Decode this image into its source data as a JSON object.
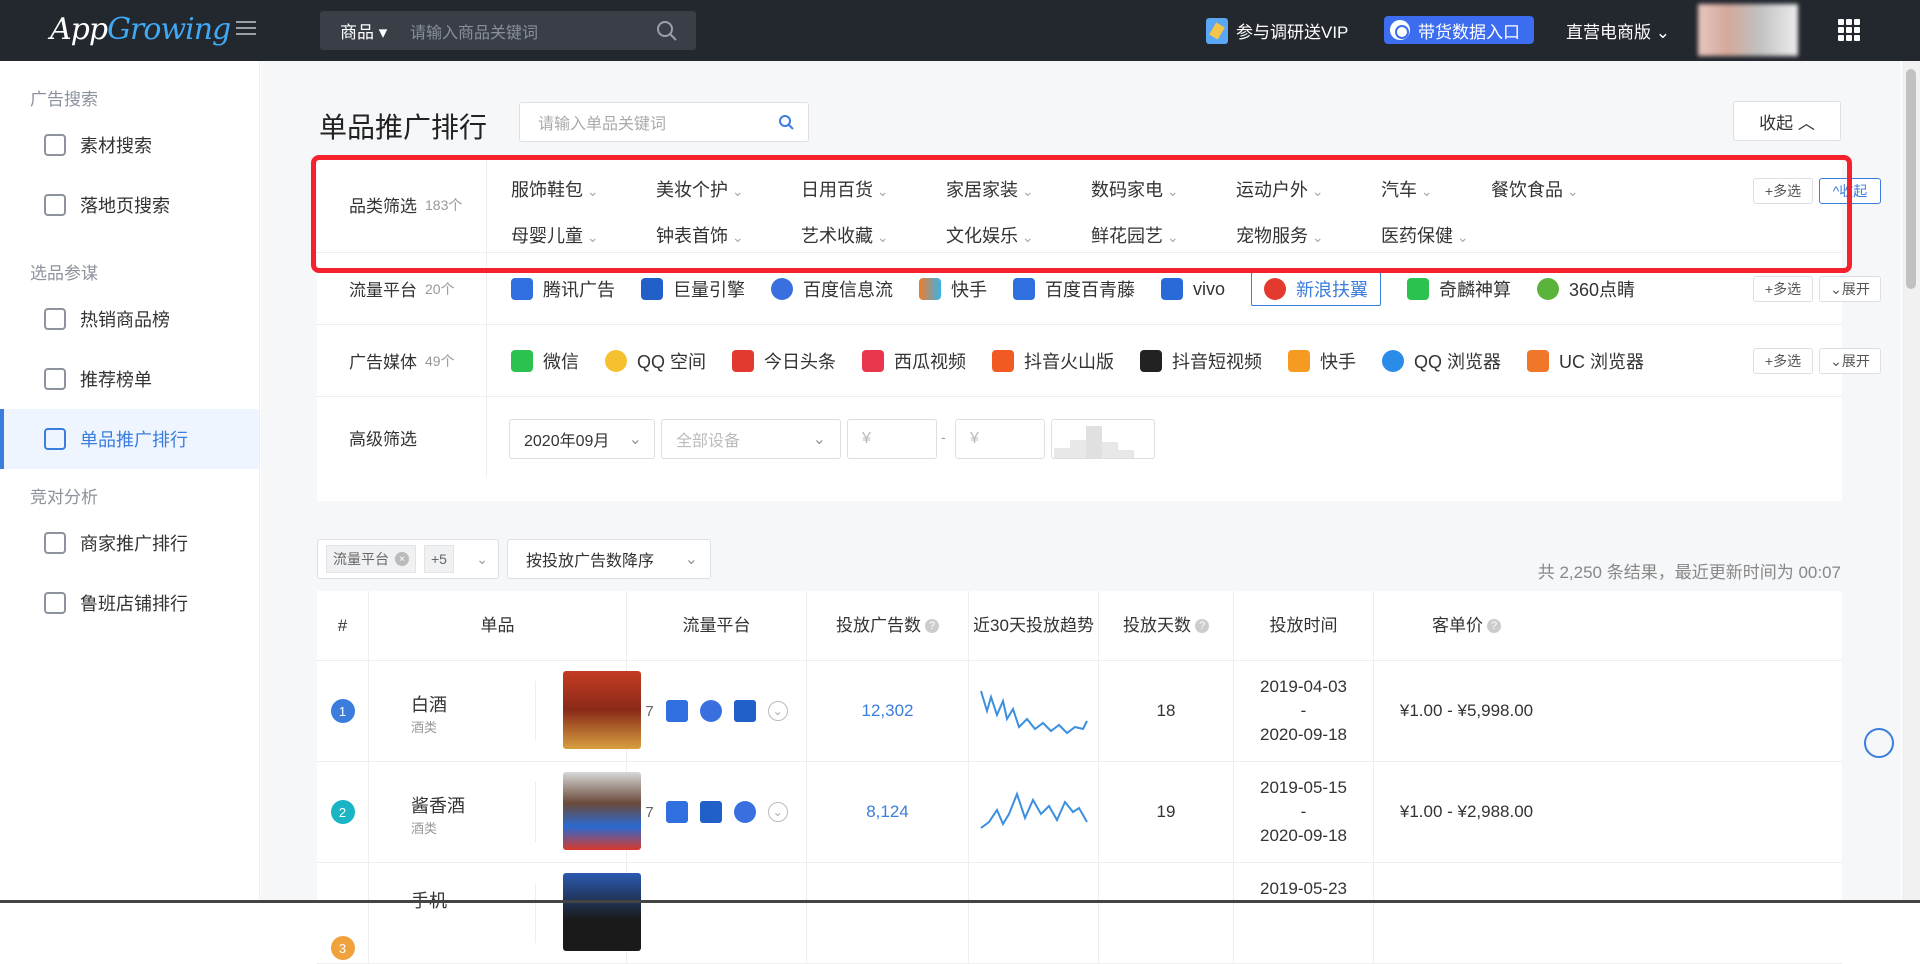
{
  "topbar": {
    "logo_a": "App",
    "logo_b": "Growing",
    "search_type": "商品 ▾",
    "search_placeholder": "请输入商品关键词",
    "vip_label": "参与调研送VIP",
    "entry_label": "带货数据入口",
    "edition_label": "直营电商版 ⌄"
  },
  "sidebar": {
    "groups": [
      {
        "title": "广告搜索",
        "items": [
          "素材搜索",
          "落地页搜索"
        ]
      },
      {
        "title": "选品参谋",
        "items": [
          "热销商品榜",
          "推荐榜单",
          "单品推广排行"
        ]
      },
      {
        "title": "竞对分析",
        "items": [
          "商家推广排行",
          "鲁班店铺排行"
        ]
      }
    ],
    "active": "单品推广排行"
  },
  "page": {
    "title": "单品推广排行",
    "search_placeholder": "请输入单品关键词",
    "collapse": "收起 ︿"
  },
  "filters": {
    "category": {
      "label": "品类筛选",
      "count": "183个",
      "items": [
        "服饰鞋包",
        "美妆个护",
        "日用百货",
        "家居家装",
        "数码家电",
        "运动户外",
        "汽车",
        "餐饮食品",
        "母婴儿童",
        "钟表首饰",
        "艺术收藏",
        "文化娱乐",
        "鲜花园艺",
        "宠物服务",
        "医药保健"
      ],
      "multi": "+多选",
      "toggle": "^收起"
    },
    "platform": {
      "label": "流量平台",
      "count": "20个",
      "items": [
        {
          "name": "腾讯广告",
          "color": "#2f6fe0"
        },
        {
          "name": "巨量引擎",
          "color": "#2060c8"
        },
        {
          "name": "百度信息流",
          "color": "#3a6fe0"
        },
        {
          "name": "快手",
          "color": "#f07b2a"
        },
        {
          "name": "百度百青藤",
          "color": "#2f6fe0"
        },
        {
          "name": "vivo",
          "color": "#2a6ad8"
        },
        {
          "name": "新浪扶翼",
          "color": "#e23a2e"
        },
        {
          "name": "奇麟神算",
          "color": "#2bc24f"
        },
        {
          "name": "360点睛",
          "color": "#5ab43c"
        }
      ],
      "selected": "新浪扶翼",
      "multi": "+多选",
      "toggle": "⌄展开"
    },
    "media": {
      "label": "广告媒体",
      "count": "49个",
      "items": [
        {
          "name": "微信",
          "color": "#2bc24f"
        },
        {
          "name": "QQ 空间",
          "color": "#f5c12e"
        },
        {
          "name": "今日头条",
          "color": "#e23a2e"
        },
        {
          "name": "西瓜视频",
          "color": "#e8374c"
        },
        {
          "name": "抖音火山版",
          "color": "#f25a24"
        },
        {
          "name": "抖音短视频",
          "color": "#222222"
        },
        {
          "name": "快手",
          "color": "#f59b22"
        },
        {
          "name": "QQ 浏览器",
          "color": "#2a8ce8"
        },
        {
          "name": "UC 浏览器",
          "color": "#f0772a"
        }
      ],
      "multi": "+多选",
      "toggle": "⌄展开"
    },
    "advanced": {
      "label": "高级筛选",
      "month": "2020年09月",
      "device_placeholder": "全部设备",
      "price_min": "¥",
      "price_max": "¥",
      "dash": "-"
    }
  },
  "toolbar": {
    "tag": "流量平台",
    "tag_more": "+5",
    "sort": "按投放广告数降序",
    "result": "共 2,250 条结果，最近更新时间为 00:07"
  },
  "table": {
    "headers": [
      "#",
      "单品",
      "流量平台",
      "投放广告数",
      "近30天投放趋势",
      "投放天数",
      "投放时间",
      "客单价"
    ],
    "rows": [
      {
        "rank": "1",
        "rank_color": "#3b7ddd",
        "name": "白酒",
        "cat": "酒类",
        "plat_count": "7",
        "ads": "12,302",
        "days": "18",
        "start": "2019-04-03",
        "end": "2020-09-18",
        "price": "¥1.00 - ¥5,998.00",
        "thumb_color": "#b5442a"
      },
      {
        "rank": "2",
        "rank_color": "#19b5c4",
        "name": "酱香酒",
        "cat": "酒类",
        "plat_count": "7",
        "ads": "8,124",
        "days": "19",
        "start": "2019-05-15",
        "end": "2020-09-18",
        "price": "¥1.00 - ¥2,988.00",
        "thumb_color": "#8a3a32"
      },
      {
        "rank": "3",
        "rank_color": "#f0a23c",
        "name": "手机",
        "cat": "",
        "plat_count": "",
        "ads": "",
        "days": "",
        "start": "2019-05-23",
        "end": "",
        "price": "",
        "thumb_color": "#3a5aa0"
      }
    ]
  },
  "colors": {
    "accent": "#3b7ddd",
    "highlight_box": "#f5222d",
    "topbar": "#23272e"
  }
}
